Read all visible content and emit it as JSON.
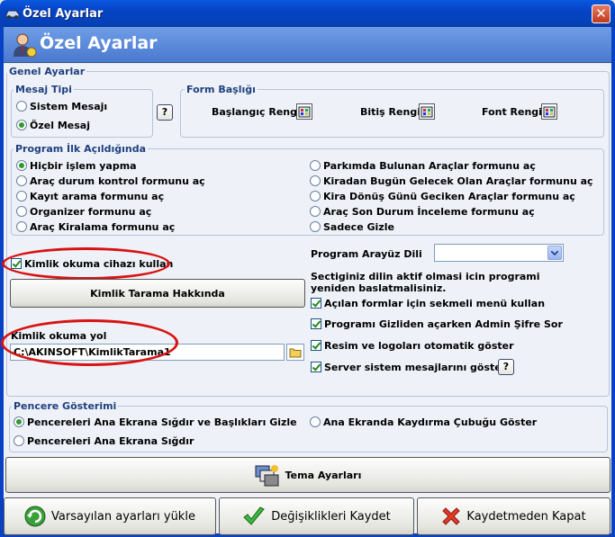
{
  "window": {
    "title": "Özel Ayarlar",
    "close_glyph": "✕"
  },
  "header": {
    "title": "Özel Ayarlar"
  },
  "general": {
    "label": "Genel Ayarlar",
    "message_type": {
      "label": "Mesaj Tipi",
      "options": [
        "Sistem Mesajı",
        "Özel Mesaj"
      ],
      "selected": 1
    },
    "help_glyph": "?",
    "form_title": {
      "label": "Form Başlığı",
      "start_color": "Başlangıç Rengi",
      "end_color": "Bitiş Rengi",
      "font_color": "Font Rengi"
    },
    "program_start": {
      "label": "Program İlk Açıldığında",
      "left": [
        "Hiçbir işlem yapma",
        "Araç durum kontrol formunu aç",
        "Kayıt arama formunu aç",
        "Organizer formunu aç",
        "Araç Kiralama formunu aç"
      ],
      "right": [
        "Parkımda Bulunan Araçlar formunu aç",
        "Kiradan Bugün Gelecek Olan Araçlar formunu aç",
        "Kira Dönüş Günü Geciken Araçlar formunu aç",
        "Araç Son Durum İnceleme formunu aç",
        "Sadece Gizle"
      ],
      "selected": "left-0"
    },
    "id_reader": {
      "checkbox_label": "Kimlik okuma cihazı kullan",
      "checked": true,
      "about_button": "Kimlik Tarama Hakkında",
      "path_label": "Kimlik okuma yol",
      "path_value": "C:\\AKINSOFT\\KimlikTarama1"
    },
    "language": {
      "label": "Program Arayüz Dili",
      "value": "",
      "note": "Sectiginiz dilin aktif olmasi icin programi yeniden baslatmalisiniz."
    },
    "options": [
      {
        "label": "Açılan formlar için sekmeli menü kullan",
        "checked": true
      },
      {
        "label": "Programı Gizliden açarken Admin Şifre Sor",
        "checked": true
      },
      {
        "label": "Resim ve logoları otomatik göster",
        "checked": true
      },
      {
        "label": "Server sistem mesajlarını göster",
        "checked": true
      }
    ]
  },
  "window_display": {
    "label": "Pencere Gösterimi",
    "options": [
      "Pencereleri Ana Ekrana Sığdır ve Başlıkları Gizle",
      "Ana Ekranda Kaydırma Çubuğu Göster",
      "Pencereleri Ana Ekrana Sığdır"
    ],
    "selected": 0
  },
  "buttons": {
    "theme": "Tema Ayarları",
    "defaults": "Varsayılan ayarları yükle",
    "save": "Değişiklikleri Kaydet",
    "cancel": "Kaydetmeden Kapat"
  },
  "colors": {
    "title_bar": "#0543c4",
    "header": "#5a88d9",
    "group_label": "#1f3f7f",
    "highlight_ellipse": "#d81212",
    "check": "#1e8a1e",
    "close_button": "#c1391c"
  }
}
